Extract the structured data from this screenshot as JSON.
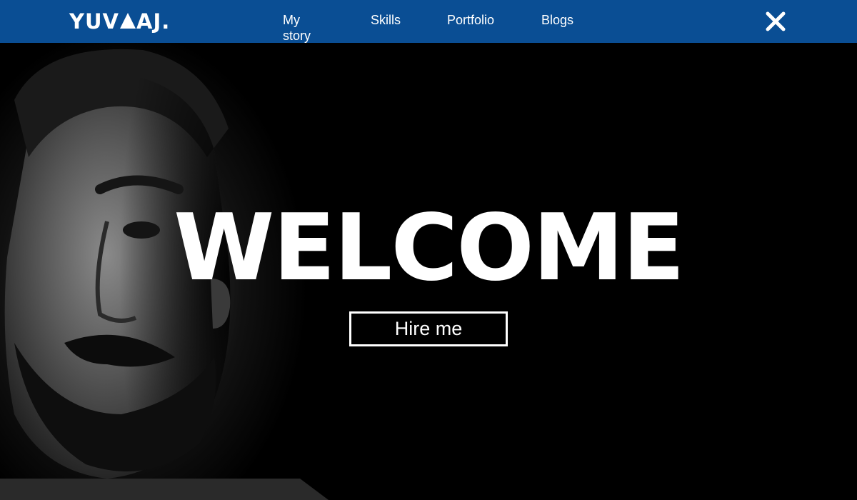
{
  "header": {
    "logo_prefix": "YUV",
    "logo_suffix": "AJ.",
    "nav": [
      {
        "label": "My story"
      },
      {
        "label": "Skills"
      },
      {
        "label": "Portfolio"
      },
      {
        "label": "Blogs"
      }
    ],
    "close_icon": "close-icon"
  },
  "hero": {
    "title": "WELCOME",
    "cta_label": "Hire me"
  },
  "colors": {
    "navbar": "#0a4e94",
    "hero_bg": "#000000",
    "text": "#ffffff"
  }
}
